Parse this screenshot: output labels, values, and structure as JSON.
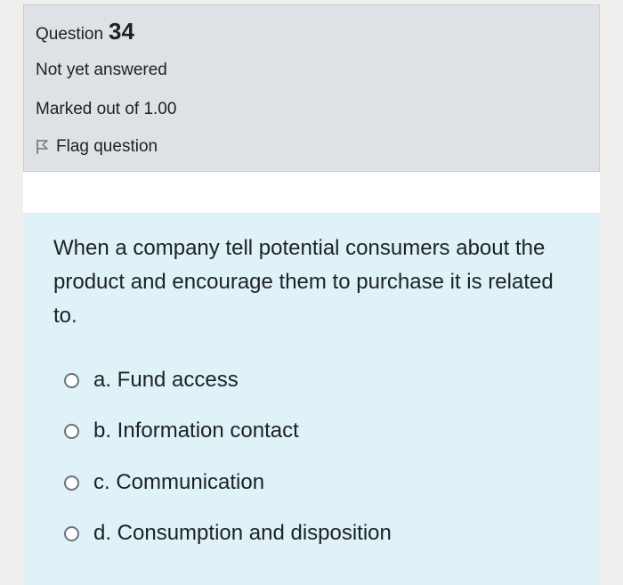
{
  "question": {
    "label": "Question",
    "number": "34",
    "state": "Not yet answered",
    "grade": "Marked out of 1.00",
    "flag_label": "Flag question",
    "text": "When a company tell potential consumers about the product and encourage them to purchase it is related to.",
    "answers": [
      {
        "label": "a. Fund access"
      },
      {
        "label": "b. Information contact"
      },
      {
        "label": "c. Communication"
      },
      {
        "label": "d. Consumption and disposition"
      }
    ]
  },
  "icons": {
    "flag": "flag-outline-icon",
    "radio": "radio-unchecked"
  },
  "colors": {
    "info_panel_bg": "#dee2e6",
    "content_panel_bg": "#def2f8",
    "text": "#1d2125"
  }
}
